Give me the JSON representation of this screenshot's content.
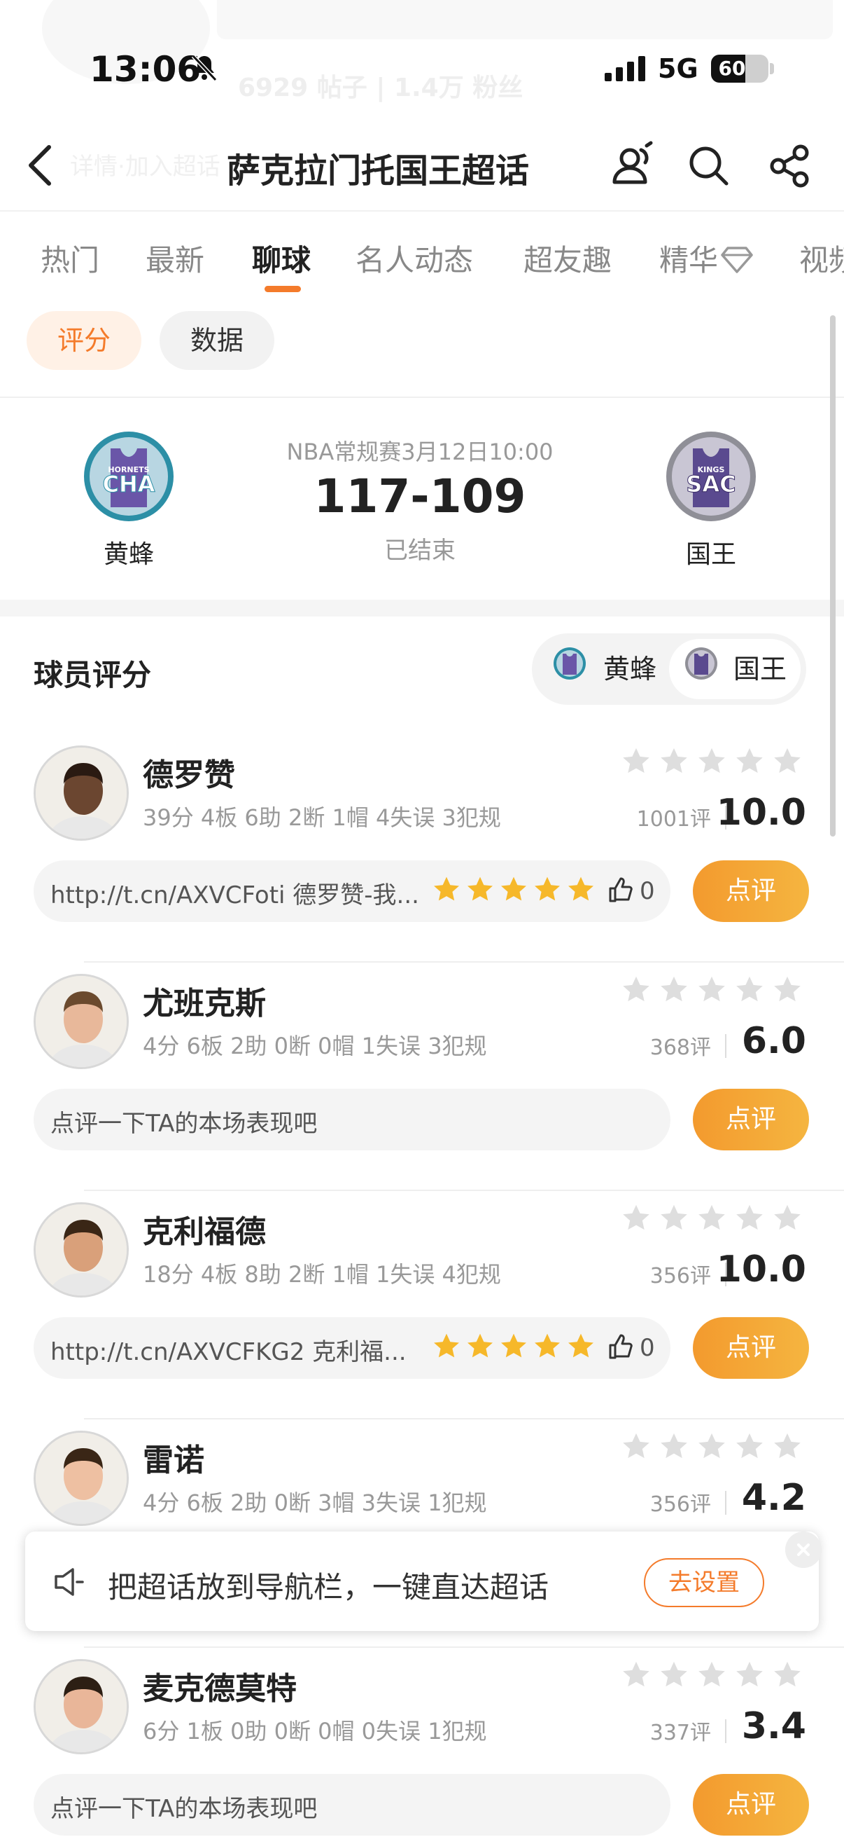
{
  "status_bar": {
    "time": "13:06",
    "network": "5G",
    "battery": "60",
    "battery_level": 0.6,
    "ghost_text": "6929 帖子 | 1.4万 粉丝"
  },
  "nav": {
    "title": "萨克拉门托国王超话",
    "ghost_text": "详情·加入超话"
  },
  "tabs": [
    {
      "label": "热门"
    },
    {
      "label": "最新"
    },
    {
      "label": "聊球"
    },
    {
      "label": "名人动态"
    },
    {
      "label": "超友趣"
    },
    {
      "label": "精华"
    },
    {
      "label": "视频"
    }
  ],
  "active_tab": "聊球",
  "subfilter": {
    "chips": [
      {
        "label": "评分"
      },
      {
        "label": "数据"
      }
    ],
    "active": "评分"
  },
  "match": {
    "info": "NBA常规赛3月12日10:00",
    "score": "117-109",
    "status": "已结束",
    "home": {
      "name": "黄蜂",
      "logo_text": "CHA",
      "logo_sub": "HORNETS",
      "color": "#2c8fa6"
    },
    "away": {
      "name": "国王",
      "logo_text": "SAC",
      "logo_sub": "KINGS",
      "color": "#5a4a8f"
    }
  },
  "ratings": {
    "title": "球员评分",
    "switch": [
      {
        "label": "黄蜂"
      },
      {
        "label": "国王"
      }
    ],
    "selected_team": "国王",
    "rate_label": "点评",
    "players": [
      {
        "name": "德罗赞",
        "stats": "39分 4板 6助 2断 1帽 4失误 3犯规",
        "reviews": "1001评",
        "score": "10.0",
        "comment": "http://t.cn/AXVCFoti 德罗赞-我...",
        "comment_rating": 5,
        "likes": "0",
        "has_comment": true
      },
      {
        "name": "尤班克斯",
        "stats": "4分 6板 2助 0断 0帽 1失误 3犯规",
        "reviews": "368评",
        "score": "6.0",
        "comment": "点评一下TA的本场表现吧",
        "has_comment": false
      },
      {
        "name": "克利福德",
        "stats": "18分 4板 8助 2断 1帽 1失误 4犯规",
        "reviews": "356评",
        "score": "10.0",
        "comment": "http://t.cn/AXVCFKG2 克利福...",
        "comment_rating": 5,
        "likes": "0",
        "has_comment": true
      },
      {
        "name": "雷诺",
        "stats": "4分 6板 2助 0断 3帽 3失误 1犯规",
        "reviews": "356评",
        "score": "4.2",
        "comment": "",
        "has_comment": false
      },
      {
        "name": "麦克德莫特",
        "stats": "6分 1板 0助 0断 0帽 0失误 1犯规",
        "reviews": "337评",
        "score": "3.4",
        "comment": "点评一下TA的本场表现吧",
        "has_comment": false
      }
    ]
  },
  "banner": {
    "text": "把超话放到导航栏，一键直达超话",
    "button": "去设置"
  },
  "colors": {
    "accent": "#f47b2b",
    "star_empty": "#dedede",
    "star_gold": "#f6b82a"
  }
}
